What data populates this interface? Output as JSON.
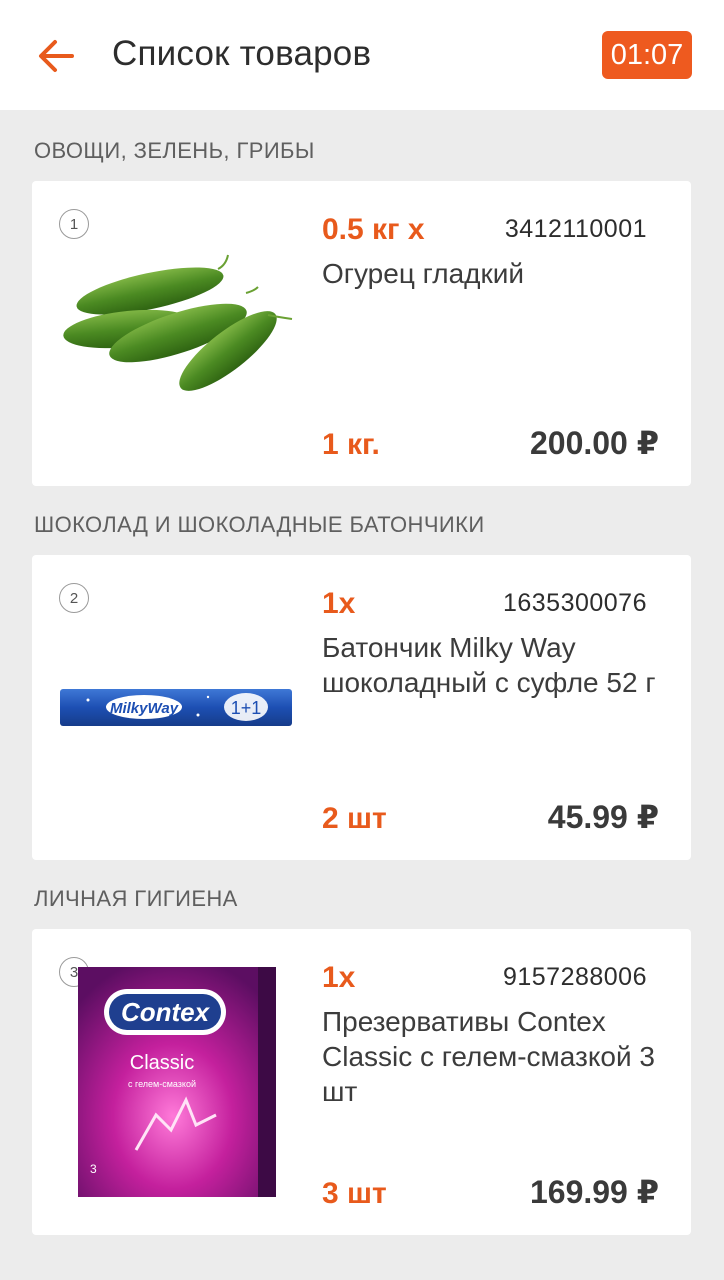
{
  "header": {
    "title": "Список товаров",
    "timer": "01:07",
    "back_icon": "arrow-left-icon",
    "accent": "#ee5a1f"
  },
  "sections": [
    {
      "category": "ОВОЩИ, ЗЕЛЕНЬ, ГРИБЫ",
      "item": {
        "index": "1",
        "qty": "0.5 кг x",
        "code": "3412110001",
        "name": "Огурец гладкий",
        "amount": "1 кг.",
        "price": "200.00 ₽",
        "image": "cucumbers-image"
      }
    },
    {
      "category": "ШОКОЛАД И ШОКОЛАДНЫЕ БАТОНЧИКИ",
      "item": {
        "index": "2",
        "qty": "1x",
        "code": "1635300076",
        "name": "Батончик Milky Way шоколадный с суфле 52 г",
        "amount": "2 шт",
        "price": "45.99 ₽",
        "image": "milky-way-bar-image",
        "image_text": [
          "MilkyWay",
          "1+1"
        ]
      }
    },
    {
      "category": "ЛИЧНАЯ ГИГИЕНА",
      "item": {
        "index": "3",
        "qty": "1x",
        "code": "9157288006",
        "name": "Презервативы Contex Classic с гелем-смазкой 3 шт",
        "amount": "3 шт",
        "price": "169.99 ₽",
        "image": "contex-box-image",
        "image_text": [
          "Contex",
          "Classic",
          "с гелем-смазкой",
          "3"
        ]
      }
    }
  ]
}
